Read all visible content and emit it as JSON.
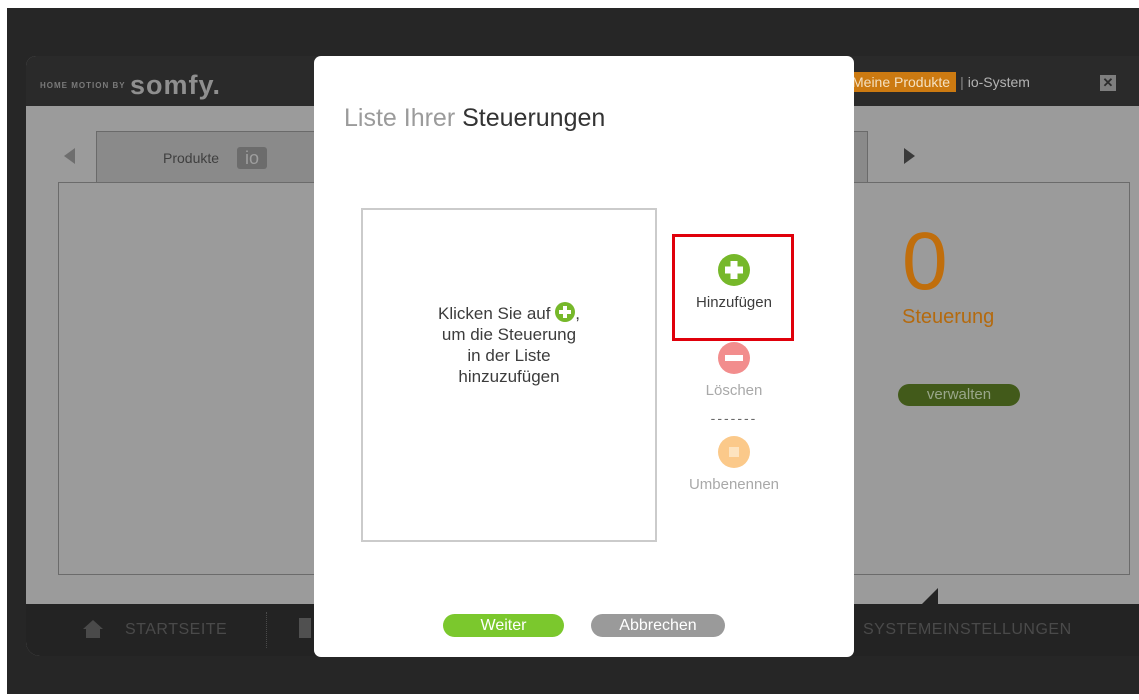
{
  "header": {
    "brand_small": "HOME MOTION BY",
    "brand_logo": "somfy.",
    "nav_active": "Meine Produkte",
    "nav_separator": "|",
    "nav_system": "io-System",
    "close_symbol": "✕"
  },
  "tabs": {
    "products_label": "Produkte",
    "io_badge": "io"
  },
  "summary": {
    "count": "0",
    "count_label": "Steuerung",
    "manage_label": "verwalten"
  },
  "bottom_nav": {
    "home_label": "STARTSEITE",
    "settings_label": "SYSTEMEINSTELLUNGEN"
  },
  "dialog": {
    "title_light": "Liste Ihrer",
    "title_dark": "Steuerungen",
    "hint_line1_before": "Klicken Sie auf",
    "hint_line1_after": ",",
    "hint_line2": "um die Steuerung",
    "hint_line3": "in der Liste",
    "hint_line4": "hinzuzufügen",
    "add_label": "Hinzufügen",
    "delete_label": "Löschen",
    "separator": "-------",
    "rename_label": "Umbenennen",
    "next_button": "Weiter",
    "cancel_button": "Abbrechen"
  },
  "colors": {
    "add_green": "#76b82a",
    "delete_red": "#f28d8d",
    "rename_orange": "#fbc98a",
    "highlight_red": "#e0000b",
    "accent_orange": "#c06e0c"
  },
  "icons": {
    "add": "plus-circle-icon",
    "delete": "minus-circle-icon",
    "rename": "square-circle-icon",
    "home": "home-icon",
    "nav_left": "arrow-left-icon",
    "nav_right": "arrow-right-icon",
    "close": "close-icon"
  }
}
